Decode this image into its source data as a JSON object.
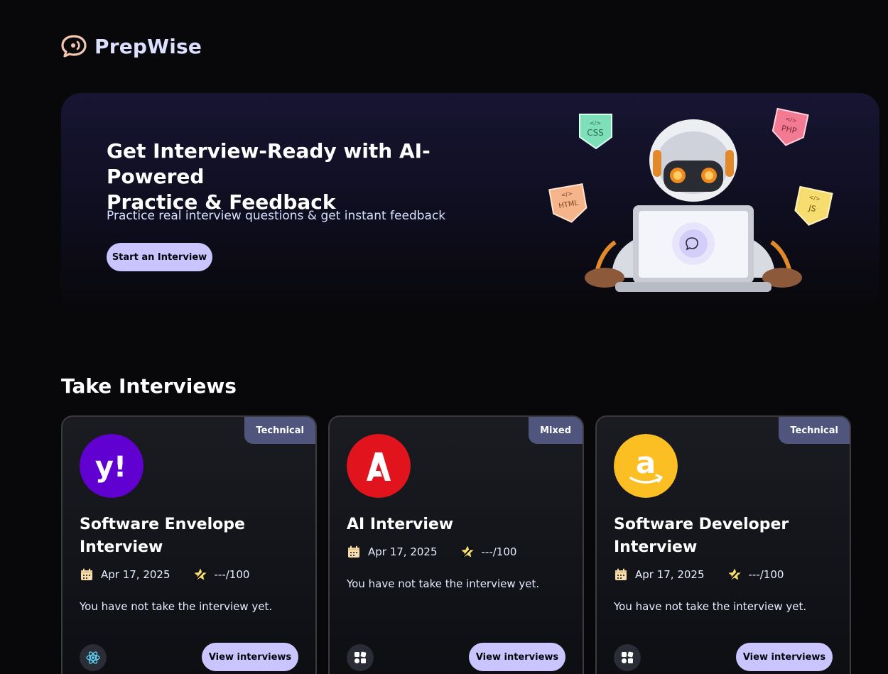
{
  "brand": {
    "name": "PrepWise",
    "logo_icon": "chat-bubble-logo-icon"
  },
  "hero": {
    "title": "Get Interview-Ready with AI-Powered\nPractice & Feedback",
    "subtitle": "Practice real interview questions & get instant feedback",
    "cta_label": "Start an Interview",
    "illustration": "robot-with-laptop",
    "tags": [
      "CSS",
      "PHP",
      "HTML",
      "JS"
    ]
  },
  "section": {
    "title": "Take Interviews"
  },
  "cards": [
    {
      "badge": "Technical",
      "company_icon": "yahoo-logo-icon",
      "company_text": "y!",
      "title": "Software Envelope Interview",
      "date": "Apr 17, 2025",
      "score": "---/100",
      "description": "You have not take the interview yet.",
      "tech_icon": "react-icon",
      "button_label": "View interviews"
    },
    {
      "badge": "Mixed",
      "company_icon": "adobe-logo-icon",
      "company_text": "",
      "title": "AI Interview",
      "date": "Apr 17, 2025",
      "score": "---/100",
      "description": "You have not take the interview yet.",
      "tech_icon": "tech-stack-icon",
      "button_label": "View interviews"
    },
    {
      "badge": "Technical",
      "company_icon": "amazon-logo-icon",
      "company_text": "a",
      "title": "Software Developer Interview",
      "date": "Apr 17, 2025",
      "score": "---/100",
      "description": "You have not take the interview yet.",
      "tech_icon": "tech-stack-icon",
      "button_label": "View interviews"
    }
  ],
  "colors": {
    "background": "#08080a",
    "accent": "#cac5fe",
    "badge": "#4f557d",
    "yahoo": "#6001d2",
    "adobe": "#e1141e",
    "amazon": "#fbbf24"
  }
}
